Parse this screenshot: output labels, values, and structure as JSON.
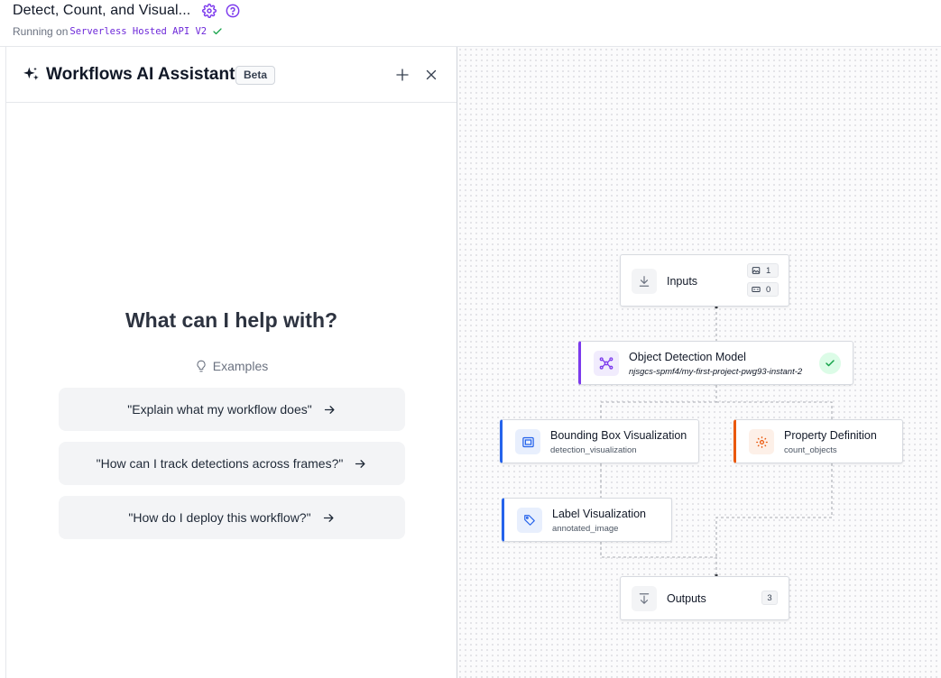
{
  "header": {
    "title": "Detect, Count, and Visual...",
    "running_label": "Running on",
    "environment": "Serverless Hosted API V2",
    "settings_icon": "gear-icon",
    "help_icon": "help-circle-icon",
    "accent_color": "#7c3aed"
  },
  "assistant": {
    "title": "Workflows AI Assistant",
    "badge": "Beta",
    "prompt_heading": "What can I help with?",
    "examples_label": "Examples",
    "examples": [
      "\"Explain what my workflow does\"",
      "\"How can I track detections across frames?\"",
      "\"How do I deploy this workflow?\""
    ]
  },
  "workflow": {
    "nodes": {
      "inputs": {
        "name": "Inputs",
        "image_count": "1",
        "param_count": "0",
        "icon": "download-icon"
      },
      "detection": {
        "name": "Object Detection Model",
        "model_id": "njsgcs-spmf4/my-first-project-pwg93-instant-2",
        "icon": "network-icon",
        "accent": "#7c3aed"
      },
      "bbox": {
        "name": "Bounding Box Visualization",
        "output": "detection_visualization",
        "icon": "image-box-icon",
        "accent": "#2563eb"
      },
      "property": {
        "name": "Property Definition",
        "output": "count_objects",
        "icon": "gear-icon",
        "accent": "#ea580c"
      },
      "label": {
        "name": "Label Visualization",
        "output": "annotated_image",
        "icon": "tag-icon",
        "accent": "#2563eb"
      },
      "outputs": {
        "name": "Outputs",
        "count": "3",
        "icon": "arrow-down-icon"
      }
    }
  }
}
